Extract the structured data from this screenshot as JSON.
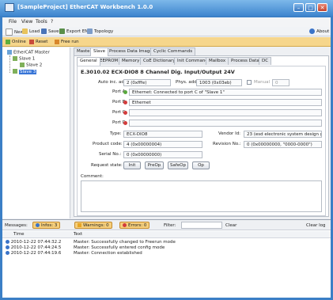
{
  "window": {
    "title": "[SampleProject] EtherCAT Workbench 1.0.0"
  },
  "menu": [
    "File",
    "View",
    "Tools",
    "?"
  ],
  "toolbar": {
    "new": "New",
    "load": "Load",
    "save": "Save",
    "export": "Export ENI",
    "topology": "Topology",
    "about": "About"
  },
  "mode_toolbar": {
    "online": "Online",
    "reset": "Reset",
    "free_run": "Free run"
  },
  "tree": {
    "master": "EtherCAT Master",
    "slave1": "Slave 1",
    "slave2": "Slave 2",
    "slave3": "Slave 3"
  },
  "outer_tabs": [
    "Master",
    "Slave",
    "Process Data Image",
    "Cyclic Commands"
  ],
  "inner_tabs": [
    "General",
    "EEPROM",
    "Memory",
    "CoE Dictionary",
    "Init Commands",
    "Mailbox",
    "Process Data",
    "DC"
  ],
  "general": {
    "heading": "E.3010.02 ECX-DIO8 8 Channel Dig. Input/Output 24V",
    "auto_inc_label": "Auto inc. addr.:",
    "auto_inc_value": "2 (0xfffe)",
    "phys_label": "Phys. addr.:",
    "phys_value": "1003 (0x03eb)",
    "manual_label": "Manual",
    "manual_value": "0",
    "portA_label": "Port A:",
    "portA_value": "Ethernet: Connected to port C of \"Slave 1\"",
    "portB_label": "Port B:",
    "portB_value": "Ethernet",
    "portC_label": "Port C:",
    "portC_value": "",
    "portD_label": "Port D:",
    "portD_value": "",
    "type_label": "Type:",
    "type_value": "ECX-DIO8",
    "vendor_label": "Vendor Id:",
    "vendor_value": "23 (esd electronic system design gmbh)",
    "product_label": "Product code:",
    "product_value": "4 (0x00000004)",
    "revision_label": "Revision No.:",
    "revision_value": "0 (0x00000000, \"0000-0000\")",
    "serial_label": "Serial No.:",
    "serial_value": "0 (0x00000000)",
    "request_label": "Request state:",
    "states": [
      "Init",
      "PreOp",
      "SafeOp",
      "Op"
    ],
    "comment_label": "Comment:"
  },
  "messages": {
    "label": "Messages:",
    "info": "Infos: 3",
    "warnings": "Warnings: 0",
    "errors": "Errors: 0",
    "filter_label": "Filter:",
    "clear": "Clear",
    "clear_log": "Clear log",
    "col_time": "Time",
    "col_text": "Text",
    "rows": [
      {
        "time": "2010-12-22 07:44:32.2",
        "text": "Master: Successfully changed to Freerun mode"
      },
      {
        "time": "2010-12-22 07:44:24.5",
        "text": "Master: Successfully entered config mode"
      },
      {
        "time": "2010-12-22 07:44:19.6",
        "text": "Master: Connection established"
      }
    ]
  },
  "colors": {
    "titlebar": "#3f86cf",
    "accent": "#f6cf7c",
    "selection": "#3875d7"
  }
}
